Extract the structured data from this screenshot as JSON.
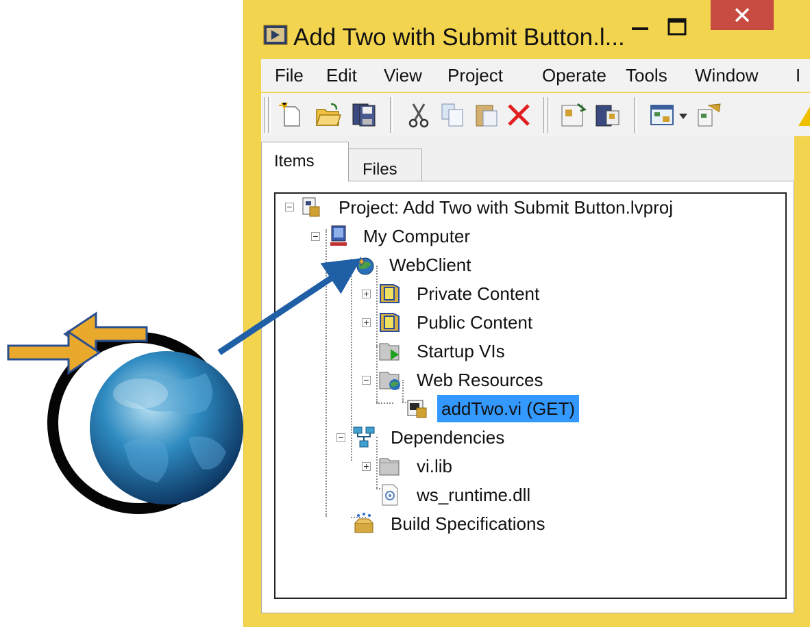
{
  "window": {
    "title": "Add Two with Submit Button.l...",
    "controls": {
      "minimize": "minimize-icon",
      "maximize": "maximize-icon",
      "close": "close-icon",
      "close_color": "#c74b41"
    }
  },
  "menu": [
    "File",
    "Edit",
    "View",
    "Project",
    "Operate",
    "Tools",
    "Window",
    "I"
  ],
  "toolbar_icons": [
    "new-file-icon",
    "open-folder-icon",
    "save-all-icon",
    "cut-icon",
    "copy-icon",
    "paste-icon",
    "delete-icon",
    "build-icon",
    "deploy-icon",
    "view-icon",
    "dropdown-icon",
    "project-icon"
  ],
  "tabs": [
    "Items",
    "Files"
  ],
  "tree": {
    "project": "Project: Add Two with Submit Button.lvproj",
    "computer": "My Computer",
    "webclient": "WebClient",
    "private_content": "Private Content",
    "public_content": "Public Content",
    "startup_vis": "Startup VIs",
    "web_resources": "Web Resources",
    "addtwo": "addTwo.vi (GET)",
    "dependencies": "Dependencies",
    "vilib": "vi.lib",
    "ws_runtime": "ws_runtime.dll",
    "build_specs": "Build Specifications"
  },
  "colors": {
    "window_frame": "#f3d44f",
    "selection": "#3399ff",
    "arrow": "#1f5fa6",
    "orange_arrow": "#e8a92c"
  }
}
